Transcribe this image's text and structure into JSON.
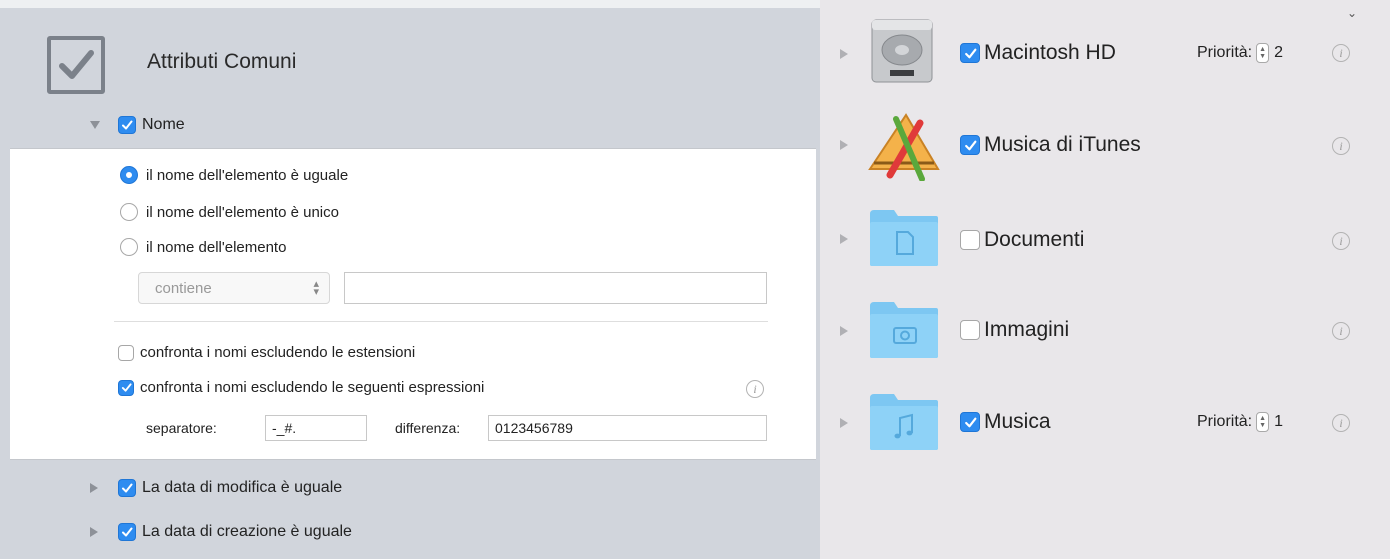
{
  "header": {
    "title": "Attributi Comuni"
  },
  "name_section": {
    "label": "Nome",
    "checked": true,
    "radios": [
      {
        "label": "il nome dell'elemento è uguale",
        "selected": true
      },
      {
        "label": "il nome dell'elemento è unico",
        "selected": false
      },
      {
        "label": "il nome dell'elemento",
        "selected": false
      }
    ],
    "condition_select": {
      "value": "contiene"
    },
    "condition_text": {
      "value": ""
    },
    "ignore_extensions": {
      "label": "confronta i nomi escludendo le estensioni",
      "checked": false
    },
    "ignore_expressions": {
      "label": "confronta i nomi escludendo le seguenti espressioni",
      "checked": true
    },
    "separator": {
      "label": "separatore:",
      "value": "-_#."
    },
    "difference": {
      "label": "differenza:",
      "value": "0123456789"
    }
  },
  "other_attributes": [
    {
      "label": "La data di modifica è uguale",
      "checked": true
    },
    {
      "label": "La data di creazione è uguale",
      "checked": true
    }
  ],
  "locations": [
    {
      "label": "Macintosh HD",
      "checked": true,
      "icon": "hard-drive-icon",
      "priority_label": "Priorità:",
      "priority": "2"
    },
    {
      "label": "Musica di iTunes",
      "checked": true,
      "icon": "applications-icon"
    },
    {
      "label": "Documenti",
      "checked": false,
      "icon": "documents-folder-icon"
    },
    {
      "label": "Immagini",
      "checked": false,
      "icon": "pictures-folder-icon"
    },
    {
      "label": "Musica",
      "checked": true,
      "icon": "music-folder-icon",
      "priority_label": "Priorità:",
      "priority": "1"
    }
  ],
  "colors": {
    "accent": "#2e8cf0",
    "left_panel": "#d1d5dc",
    "right_panel": "#e9e7ea",
    "folder": "#7dc7f2"
  }
}
